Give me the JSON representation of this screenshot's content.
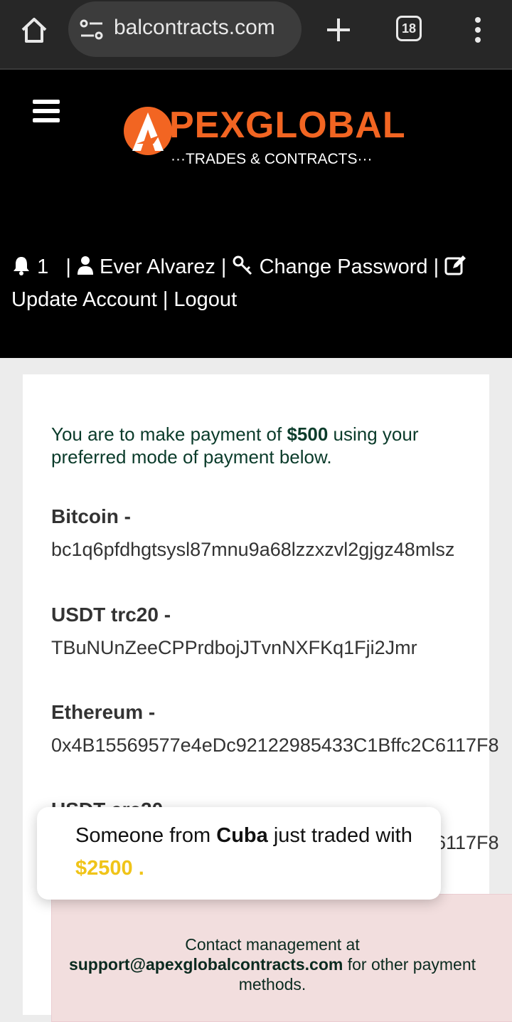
{
  "browser": {
    "url": "balcontracts.com",
    "tab_count": "18"
  },
  "logo": {
    "brand": "PEXGLOBAL",
    "tagline": "···TRADES & CONTRACTS···"
  },
  "user_bar": {
    "notification_count": "1",
    "user_name": "Ever Alvarez",
    "change_password": "Change Password",
    "update_account": "Update Account",
    "logout": "Logout"
  },
  "payment": {
    "intro_prefix": "You are to make payment of ",
    "amount": "$500",
    "intro_suffix": " using your preferred mode of payment below.",
    "methods": [
      {
        "label": "Bitcoin -",
        "address": "bc1q6pfdhgtsysl87mnu9a68lzzxzvl2gjgz48mlsz"
      },
      {
        "label": "USDT trc20 -",
        "address": "TBuNUnZeeCPPrdbojJTvnNXFKq1Fji2Jmr"
      },
      {
        "label": "Ethereum -",
        "address": "0x4B15569577e4eDc92122985433C1Bffc2C6117F8"
      },
      {
        "label": "USDT erc20 -",
        "address": "0x4B15569577e4eDc92122985433C1Bffc2C6117F8"
      }
    ]
  },
  "contact": {
    "prefix": "Contact management at",
    "email": "support@apexglobalcontracts.com",
    "suffix": " for other payment methods."
  },
  "toast": {
    "prefix": "Someone from ",
    "country": "Cuba",
    "suffix": " just traded with",
    "amount": "$2500 ."
  },
  "colors": {
    "brand_orange": "#f26522",
    "toast_amount": "#f0c419",
    "contact_bg": "#f2dede"
  }
}
